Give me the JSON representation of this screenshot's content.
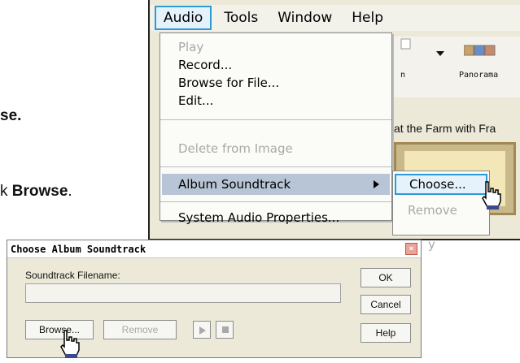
{
  "doc": {
    "line1_tail": "se.",
    "line2_prefix": "k ",
    "line2_bold": "Browse",
    "line2_period": "."
  },
  "app": {
    "menubar": [
      "Audio",
      "Tools",
      "Window",
      "Help"
    ],
    "toolbar": {
      "left_partial_label": "n",
      "panorama_label": "Panorama"
    },
    "album_title_partial": "at the Farm with Fra"
  },
  "audio_menu": {
    "items": {
      "play": "Play",
      "record": "Record...",
      "browse": "Browse for File...",
      "edit": "Edit...",
      "delete": "Delete from Image",
      "album_soundtrack": "Album Soundtrack",
      "system_audio": "System Audio Properties..."
    }
  },
  "submenu": {
    "choose": "Choose...",
    "remove": "Remove",
    "partial_text": "y"
  },
  "dialog": {
    "title": "Choose Album Soundtrack",
    "filename_label": "Soundtrack Filename:",
    "filename_value": "",
    "buttons": {
      "ok": "OK",
      "cancel": "Cancel",
      "help": "Help",
      "browse": "Browse...",
      "remove": "Remove"
    }
  },
  "colors": {
    "menu_highlight": "#2b9ad6",
    "menu_selection_bg": "#b8c5d6",
    "disabled_text": "#a9a9a9"
  }
}
